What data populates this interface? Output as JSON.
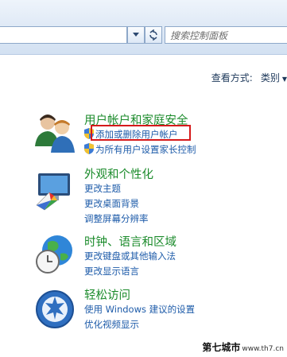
{
  "search": {
    "placeholder": "搜索控制面板"
  },
  "toolbar": {
    "nav_glyph": "↯"
  },
  "view_by": {
    "label": "查看方式:",
    "value": "类别"
  },
  "categories": [
    {
      "title": "用户帐户和家庭安全",
      "links": [
        "添加或删除用户帐户",
        "为所有用户设置家长控制"
      ],
      "icon": "users-icon"
    },
    {
      "title": "外观和个性化",
      "links": [
        "更改主题",
        "更改桌面背景",
        "调整屏幕分辨率"
      ],
      "icon": "appearance-icon"
    },
    {
      "title": "时钟、语言和区域",
      "links": [
        "更改键盘或其他输入法",
        "更改显示语言"
      ],
      "icon": "clock-globe-icon"
    },
    {
      "title": "轻松访问",
      "links": [
        "使用 Windows 建议的设置",
        "优化视频显示"
      ],
      "icon": "ease-of-access-icon"
    }
  ],
  "watermark": {
    "main": "第七城市",
    "sub": "www.th7.cn"
  },
  "colors": {
    "title_green": "#1b8b2b",
    "link_blue": "#1d5ba9",
    "highlight_red": "#d6191a"
  }
}
